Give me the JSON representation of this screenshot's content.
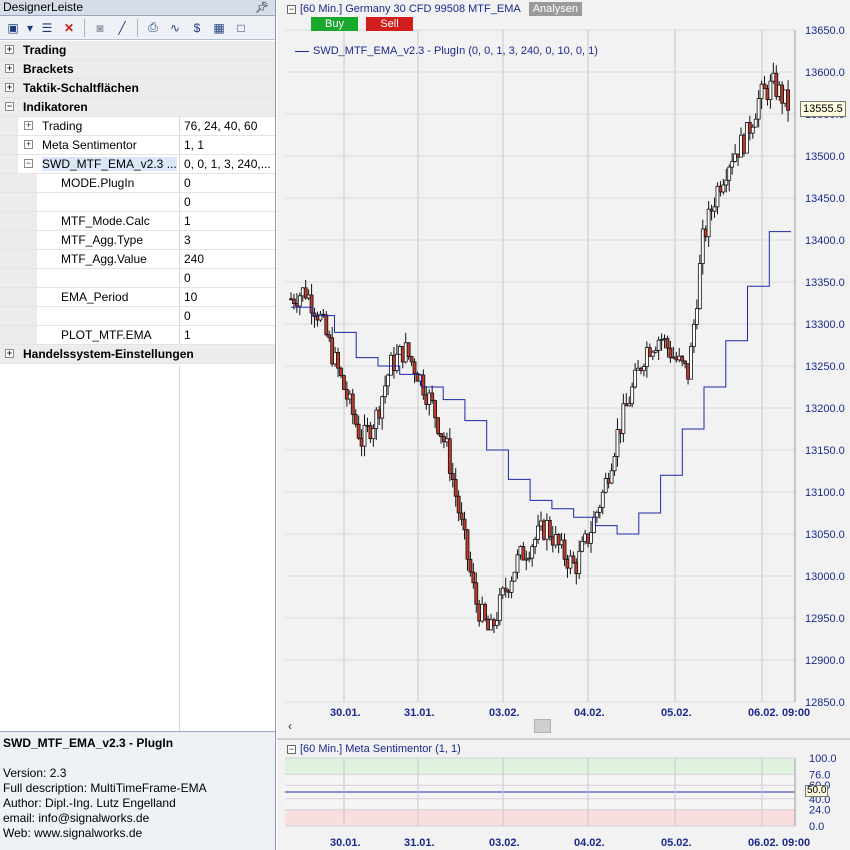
{
  "panel": {
    "title": "DesignerLeiste",
    "pin_icon": "pin-icon",
    "toolbar_icons": [
      "chart-wizard-icon",
      "dropdown-icon",
      "list-icon",
      "delete-icon",
      "user-icon",
      "indicator-icon",
      "print-icon",
      "drawing-icon",
      "currency-icon",
      "grid-icon",
      "window-icon"
    ],
    "tree": [
      {
        "kind": "cat",
        "label": "Trading"
      },
      {
        "kind": "cat",
        "label": "Brackets"
      },
      {
        "kind": "cat",
        "label": "Taktik-Schaltflächen"
      },
      {
        "kind": "cat",
        "label": "Indikatoren",
        "expanded": true
      },
      {
        "kind": "sub",
        "label": "Trading",
        "value": "76, 24, 40, 60"
      },
      {
        "kind": "sub",
        "label": "Meta Sentimentor",
        "value": "1, 1"
      },
      {
        "kind": "sub",
        "label": "SWD_MTF_EMA_v2.3 ...",
        "value": "0, 0, 1, 3, 240,...",
        "expanded": true
      },
      {
        "kind": "param",
        "label": "MODE.PlugIn",
        "value": "0"
      },
      {
        "kind": "param",
        "label": "",
        "value": "0"
      },
      {
        "kind": "param",
        "label": "MTF_Mode.Calc",
        "value": "1"
      },
      {
        "kind": "param",
        "label": "MTF_Agg.Type",
        "value": "3"
      },
      {
        "kind": "param",
        "label": "MTF_Agg.Value",
        "value": "240"
      },
      {
        "kind": "param",
        "label": "",
        "value": "0"
      },
      {
        "kind": "param",
        "label": "EMA_Period",
        "value": "10"
      },
      {
        "kind": "param",
        "label": "",
        "value": "0"
      },
      {
        "kind": "param",
        "label": "PLOT_MTF.EMA",
        "value": "1"
      },
      {
        "kind": "cat",
        "label": "Handelssystem-Einstellungen"
      }
    ],
    "description": {
      "title": "SWD_MTF_EMA_v2.3 - PlugIn",
      "version": "Version: 2.3",
      "full": "Full description: MultiTimeFrame-EMA",
      "author": "Author: Dipl.-Ing. Lutz Engelland",
      "email": "email: info@signalworks.de",
      "web": "Web: www.signalworks.de"
    }
  },
  "chart": {
    "header": "[60 Min.] Germany 30 CFD   99508 MTF_EMA",
    "analysen": "Analysen",
    "buy": "Buy",
    "sell": "Sell",
    "legend": "SWD_MTF_EMA_v2.3 - PlugIn  (0, 0, 1, 3, 240, 0, 10, 0, 1)",
    "last_price": "13555.5",
    "price_ticks": [
      "13650.0",
      "13600.0",
      "13550.0",
      "13500.0",
      "13450.0",
      "13400.0",
      "13350.0",
      "13300.0",
      "13250.0",
      "13200.0",
      "13150.0",
      "13100.0",
      "13050.0",
      "13000.0",
      "12950.0",
      "12900.0",
      "12850.0"
    ],
    "date_ticks": [
      "30.01.",
      "31.01.",
      "03.02.",
      "04.02.",
      "05.02.",
      "06.02.",
      "09:00"
    ],
    "sub_header": "[60 Min.] Meta Sentimentor  (1, 1)",
    "sub_ticks": [
      "100.0",
      "76.0",
      "60.0",
      "40.0",
      "24.0",
      "0.0"
    ],
    "sub_value": "50.0",
    "colors": {
      "up": "#ffffff",
      "down": "#c0392b",
      "ema": "#1a2aa8",
      "buy": "#17a82d",
      "sell": "#d21d1d"
    }
  },
  "chart_data": {
    "type": "candlestick",
    "ylim": [
      12850,
      13650
    ],
    "ema_steps": [
      13320,
      13310,
      13290,
      13260,
      13250,
      13240,
      13225,
      13210,
      13185,
      13150,
      13115,
      13090,
      13080,
      13070,
      13060,
      13050,
      13075,
      13120,
      13175,
      13225,
      13280,
      13345,
      13410
    ],
    "close": [
      13330,
      13340,
      13310,
      13260,
      13210,
      13160,
      13190,
      13250,
      13270,
      13240,
      13200,
      13150,
      13060,
      12970,
      12930,
      12980,
      13020,
      13040,
      13060,
      13030,
      13010,
      13050,
      13100,
      13170,
      13220,
      13270,
      13285,
      13260,
      13240,
      13400,
      13460,
      13500,
      13520,
      13570,
      13585,
      13560
    ]
  }
}
